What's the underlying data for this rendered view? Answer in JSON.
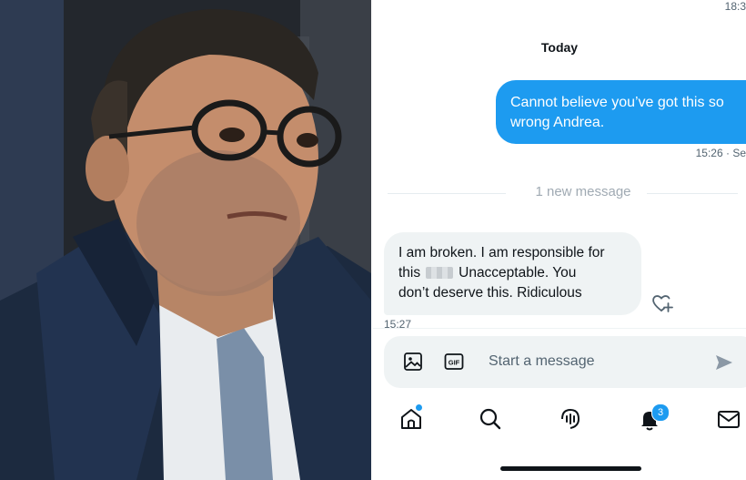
{
  "chat": {
    "top_time": "18:3",
    "day_label": "Today",
    "outgoing": {
      "text": "Cannot believe you’ve got this so wrong Andrea.",
      "meta": "15:26 · Se"
    },
    "new_message_label": "1 new message",
    "incoming": {
      "line1": "I am broken. I am responsible for",
      "line2_prefix": "this",
      "line2_suffix": "Unacceptable. You",
      "line3": "don’t deserve this. Ridiculous",
      "time": "15:27"
    },
    "composer": {
      "placeholder": "Start a message",
      "image_icon": "image-icon",
      "gif_label": "GIF",
      "send_icon": "send-icon"
    },
    "tabbar": {
      "items": [
        "home-icon",
        "search-icon",
        "spaces-icon",
        "notifications-icon",
        "messages-icon"
      ],
      "notification_count": "3"
    }
  },
  "colors": {
    "accent": "#1d9bf0",
    "bubble_in": "#eff3f4",
    "muted": "#536471"
  }
}
